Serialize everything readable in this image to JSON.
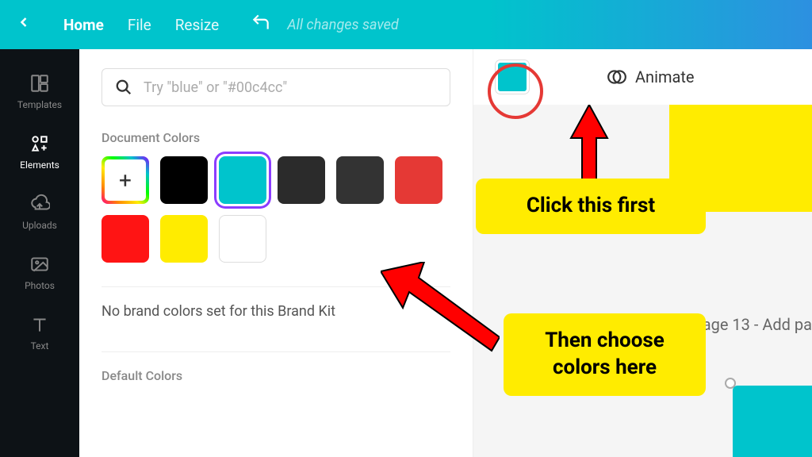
{
  "topbar": {
    "home": "Home",
    "file": "File",
    "resize": "Resize",
    "saved": "All changes saved"
  },
  "sidebar": {
    "items": [
      {
        "label": "Templates"
      },
      {
        "label": "Elements"
      },
      {
        "label": "Uploads"
      },
      {
        "label": "Photos"
      },
      {
        "label": "Text"
      }
    ]
  },
  "search": {
    "placeholder": "Try \"blue\" or \"#00c4cc\""
  },
  "sections": {
    "document_colors": "Document Colors",
    "brand_kit_empty": "No brand colors set for this Brand Kit",
    "default_colors": "Default Colors"
  },
  "doc_colors": [
    {
      "color": "#000000"
    },
    {
      "color": "#00c4cc",
      "selected": true
    },
    {
      "color": "#2b2b2b"
    },
    {
      "color": "#333333"
    },
    {
      "color": "#e53935"
    },
    {
      "color": "#ff1414"
    },
    {
      "color": "#ffec00"
    },
    {
      "color": "#ffffff",
      "bordered": true
    }
  ],
  "toolbar": {
    "animate": "Animate",
    "selected_color": "#00c4cc"
  },
  "canvas": {
    "page_label": "Page 13 - Add pa"
  },
  "annotations": {
    "callout1": "Click this first",
    "callout2": "Then choose colors here"
  }
}
